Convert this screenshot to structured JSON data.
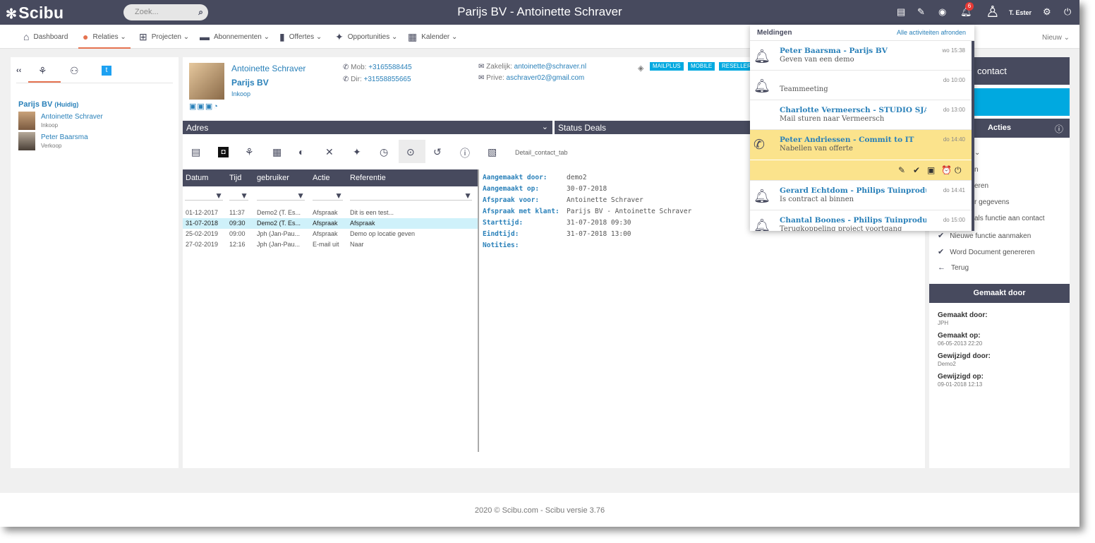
{
  "topbar": {
    "logo": "Scibu",
    "search_placeholder": "Zoek...",
    "title": "Parijs BV - Antoinette Schraver",
    "badge": "6",
    "user": "T. Ester"
  },
  "nav": {
    "items": [
      {
        "label": "Dashboard",
        "icon": "home-icon"
      },
      {
        "label": "Relaties ⌄",
        "icon": "person-icon"
      },
      {
        "label": "Projecten ⌄",
        "icon": "project-icon"
      },
      {
        "label": "Abonnementen ⌄",
        "icon": "folder-icon"
      },
      {
        "label": "Offertes ⌄",
        "icon": "document-icon"
      },
      {
        "label": "Opportunities ⌄",
        "icon": "handshake-icon"
      },
      {
        "label": "Kalender ⌄",
        "icon": "calendar-icon"
      }
    ],
    "right": "Nieuw ⌄"
  },
  "left": {
    "collapse": "‹‹",
    "company": "Parijs BV",
    "company_note": "(Huidig)",
    "persons": [
      {
        "name": "Antoinette Schraver",
        "role": "Inkoop"
      },
      {
        "name": "Peter Baarsma",
        "role": "Verkoop"
      }
    ]
  },
  "contact": {
    "name": "Antoinette Schraver",
    "company": "Parijs BV",
    "role": "Inkoop",
    "mob_label": "Mob:",
    "mob": "+3165588445",
    "dir_label": "Dir:",
    "dir": "+31558855665",
    "work_label": "Zakelijk:",
    "work_email": "antoinette@schraver.nl",
    "private_label": "Prive:",
    "private_email": "aschraver02@gmail.com",
    "tags": [
      "MAILPLUS",
      "MOBILE",
      "RESELLER"
    ]
  },
  "sections": {
    "address": "Adres",
    "deals": "Status Deals"
  },
  "tabs": {
    "label": "Detail_contact_tab"
  },
  "grid": {
    "headers": [
      "Datum",
      "Tijd",
      "gebruiker",
      "Actie",
      "Referentie"
    ],
    "rows": [
      {
        "datum": "01-12-2017",
        "tijd": "11:37",
        "gebruiker": "Demo2 (T. Es...",
        "actie": "Afspraak",
        "ref": "Dit is een test..."
      },
      {
        "datum": "31-07-2018",
        "tijd": "09:30",
        "gebruiker": "Demo2 (T. Es...",
        "actie": "Afspraak",
        "ref": "Afspraak"
      },
      {
        "datum": "25-02-2019",
        "tijd": "09:00",
        "gebruiker": "Jph (Jan-Pau...",
        "actie": "Afspraak",
        "ref": "Demo op locatie geven"
      },
      {
        "datum": "27-02-2019",
        "tijd": "12:16",
        "gebruiker": "Jph (Jan-Pau...",
        "actie": "E-mail uit",
        "ref": "Naar"
      }
    ]
  },
  "details": [
    {
      "label": "Aangemaakt door:",
      "value": "demo2"
    },
    {
      "label": "Aangemaakt op:",
      "value": "30-07-2018"
    },
    {
      "label": "Afspraak voor:",
      "value": "Antoinette Schraver"
    },
    {
      "label": "Afspraak met klant:",
      "value": "Parijs BV - Antoinette Schraver"
    },
    {
      "label": "Starttijd:",
      "value": "31-07-2018 09:30"
    },
    {
      "label": "Eindtijd:",
      "value": "31-07-2018 13:00"
    },
    {
      "label": "Notities:",
      "value": ""
    }
  ],
  "right": {
    "contact_title": "contact",
    "actions_title": "Acties",
    "actions": [
      {
        "icon": "check-icon",
        "label": "Nieuwe functie aanmaken"
      },
      {
        "icon": "check-icon",
        "label": "Word Document genereren"
      },
      {
        "icon": "arrow-left-icon",
        "label": "Terug"
      }
    ],
    "partial_actions": [
      "n",
      "eren",
      "r gegevens",
      "als functie aan contact"
    ],
    "made_title": "Gemaakt door",
    "meta": [
      {
        "label": "Gemaakt door:",
        "value": "JPH"
      },
      {
        "label": "Gemaakt op:",
        "value": "06-05-2013 22:20"
      },
      {
        "label": "Gewijzigd door:",
        "value": "Demo2"
      },
      {
        "label": "Gewijzigd op:",
        "value": "09-01-2018 12:13"
      }
    ]
  },
  "notifications": {
    "title": "Meldingen",
    "link": "Alle activiteiten afronden",
    "items": [
      {
        "icon": "bell-icon",
        "title": "Peter Baarsma - Parijs BV",
        "sub": "Geven van een demo",
        "time": "wo 15:38",
        "highlight": false
      },
      {
        "icon": "bell-icon",
        "title": "",
        "sub": "Teammeeting",
        "time": "do 10:00",
        "highlight": false
      },
      {
        "icon": "",
        "title": "Charlotte Vermeersch - STUDIO SJA...",
        "sub": "Mail sturen naar Vermeersch",
        "time": "do 13:00",
        "highlight": false
      },
      {
        "icon": "phone-icon",
        "title": "Peter Andriessen - Commit to IT",
        "sub": "Nabellen van offerte",
        "time": "do 14:40",
        "highlight": true
      },
      {
        "icon": "bell-icon",
        "title": "Gerard Echtdom - Philips Tuinproduc...",
        "sub": "Is contract al binnen",
        "time": "do 14:41",
        "highlight": false
      },
      {
        "icon": "bell-icon",
        "title": "Chantal Boones - Philips Tuinproduct...",
        "sub": "Terugkoppeling project voortgang",
        "time": "do 15:00",
        "highlight": false
      }
    ]
  },
  "footer": "2020 © Scibu.com - Scibu versie 3.76"
}
